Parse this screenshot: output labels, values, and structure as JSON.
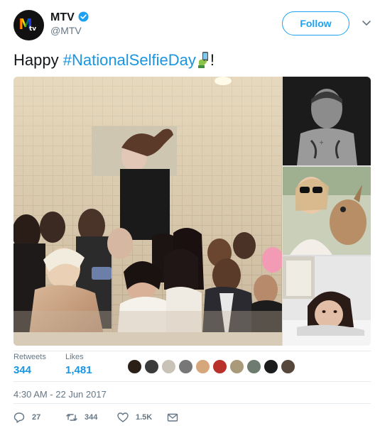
{
  "account": {
    "name": "MTV",
    "handle": "@MTV",
    "verified": true,
    "avatar_icon": "mtv-rainbow-logo"
  },
  "follow_label": "Follow",
  "tweet": {
    "text_before": "Happy ",
    "hashtag": "#NationalSelfieDay",
    "emoji_icon": "selfie-emoji",
    "text_after": "!"
  },
  "media": {
    "main_photo": "group-selfie-photo",
    "side_photos": [
      "selfie-photo-2",
      "selfie-photo-3",
      "selfie-photo-4"
    ]
  },
  "stats": {
    "retweets_label": "Retweets",
    "retweets_value": "344",
    "likes_label": "Likes",
    "likes_value": "1,481"
  },
  "likers_count": 10,
  "timestamp": "4:30 AM - 22 Jun 2017",
  "actions": {
    "reply_count": "27",
    "retweet_count": "344",
    "like_count": "1.5K"
  },
  "colors": {
    "accent": "#1da1f2",
    "link": "#1b95e0",
    "muted": "#657786"
  }
}
